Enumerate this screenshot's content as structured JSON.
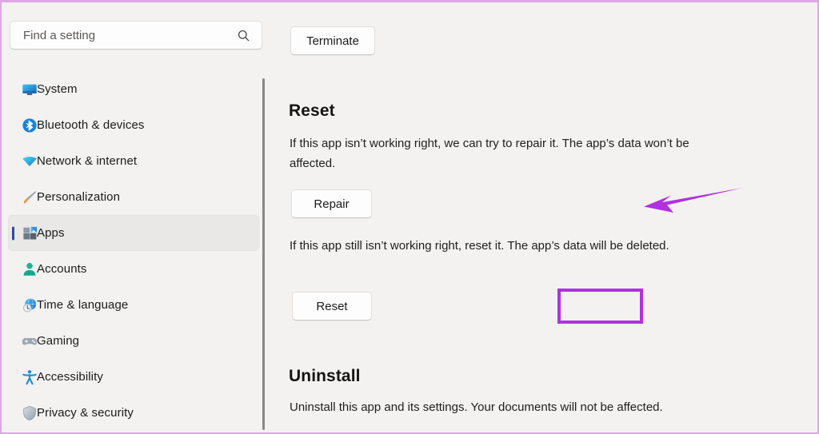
{
  "window": {
    "background_color": "#f3f2f1",
    "annotation_color": "#b131e0",
    "border_color": "#dca8e4"
  },
  "sidebar": {
    "search": {
      "placeholder": "Find a setting",
      "value": "",
      "icon": "search-icon"
    },
    "items": [
      {
        "label": "System",
        "icon": "monitor-icon",
        "selected": false
      },
      {
        "label": "Bluetooth & devices",
        "icon": "bluetooth-icon",
        "selected": false
      },
      {
        "label": "Network & internet",
        "icon": "wifi-icon",
        "selected": false
      },
      {
        "label": "Personalization",
        "icon": "paintbrush-icon",
        "selected": false
      },
      {
        "label": "Apps",
        "icon": "apps-icon",
        "selected": true
      },
      {
        "label": "Accounts",
        "icon": "person-icon",
        "selected": false
      },
      {
        "label": "Time & language",
        "icon": "clock-globe-icon",
        "selected": false
      },
      {
        "label": "Gaming",
        "icon": "gamepad-icon",
        "selected": false
      },
      {
        "label": "Accessibility",
        "icon": "accessibility-icon",
        "selected": false
      },
      {
        "label": "Privacy & security",
        "icon": "shield-icon",
        "selected": false
      }
    ]
  },
  "main": {
    "terminate_button": "Terminate",
    "reset_section": {
      "heading": "Reset",
      "repair_description": "If this app isn’t working right, we can try to repair it. The app’s data won’t be affected.",
      "repair_button": "Repair",
      "reset_description": "If this app still isn’t working right, reset it. The app’s data will be deleted.",
      "reset_button": "Reset"
    },
    "uninstall_section": {
      "heading": "Uninstall",
      "description": "Uninstall this app and its settings. Your documents will not be affected."
    }
  }
}
